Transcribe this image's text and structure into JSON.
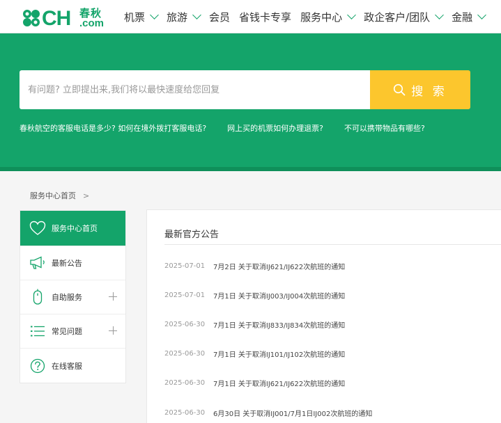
{
  "logo": {
    "ch": "CH",
    "cn": "春秋",
    "com": ".com"
  },
  "nav": [
    {
      "label": "机票",
      "chevron": true
    },
    {
      "label": "旅游",
      "chevron": true
    },
    {
      "label": "会员",
      "chevron": false
    },
    {
      "label": "省钱卡专享",
      "chevron": false
    },
    {
      "label": "服务中心",
      "chevron": true
    },
    {
      "label": "政企客户/团队",
      "chevron": true
    },
    {
      "label": "金融",
      "chevron": true
    }
  ],
  "search": {
    "placeholder": "有问题? 立即提出来,我们将以最快速度给您回复",
    "button_label": "搜 索"
  },
  "quick_links": [
    "春秋航空的客服电话是多少? 如何在境外拨打客服电话?",
    "网上买的机票如何办理退票?",
    "不可以携带物品有哪些?"
  ],
  "breadcrumb": {
    "home": "服务中心首页",
    "sep": ">"
  },
  "sidebar": [
    {
      "label": "服务中心首页",
      "icon": "heart-icon",
      "active": true,
      "expandable": false
    },
    {
      "label": "最新公告",
      "icon": "megaphone-icon",
      "active": false,
      "expandable": false
    },
    {
      "label": "自助服务",
      "icon": "mouse-icon",
      "active": false,
      "expandable": true
    },
    {
      "label": "常见问题",
      "icon": "list-icon",
      "active": false,
      "expandable": true
    },
    {
      "label": "在线客服",
      "icon": "question-icon",
      "active": false,
      "expandable": false
    }
  ],
  "main": {
    "title": "最新官方公告",
    "notices": [
      {
        "date": "2025-07-01",
        "title": "7月2日 关于取消IJ621/IJ622次航班的通知"
      },
      {
        "date": "2025-07-01",
        "title": "7月1日 关于取消IJ003/IJ004次航班的通知"
      },
      {
        "date": "2025-06-30",
        "title": "7月1日 关于取消IJ833/IJ834次航班的通知"
      },
      {
        "date": "2025-06-30",
        "title": "7月1日 关于取消IJ101/IJ102次航班的通知"
      },
      {
        "date": "2025-06-30",
        "title": "7月1日 关于取消IJ621/IJ622次航班的通知"
      },
      {
        "date": "2025-06-30",
        "title": "6月30日 关于取消IJ001/7月1日IJ002次航班的通知"
      }
    ]
  },
  "colors": {
    "brand_green": "#14a46a",
    "search_yellow": "#fcc62d"
  }
}
